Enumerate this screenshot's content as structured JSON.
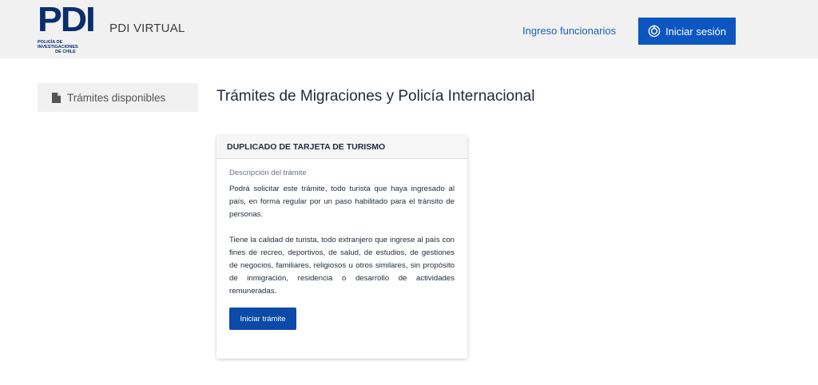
{
  "header": {
    "logo_mark": "PDI",
    "logo_sub_line1": "POLICÍA DE INVESTIGACIONES",
    "logo_sub_line2": "DE CHILE",
    "app_title": "PDI VIRTUAL",
    "officials_link": "Ingreso funcionarios",
    "login_button": "Iniciar sesión",
    "login_icon": "clave-unica-icon",
    "background_color": "#f1f1f1",
    "accent_color": "#0b56c1"
  },
  "sidebar": {
    "items": [
      {
        "label": "Trámites disponibles",
        "icon": "document-icon"
      }
    ]
  },
  "main": {
    "title": "Trámites de Migraciones y Policía Internacional",
    "card": {
      "title": "DUPLICADO DE TARJETA DE TURISMO",
      "description_label": "Descripción del trámite",
      "paragraph_1": "Podrá solicitar este trámite, todo turista que haya ingresado al país, en forma regular por un paso habilitado para el tránsito de personas.",
      "paragraph_2": "Tiene la calidad de turista, todo extranjero que ingrese al país con fines de recreo, deportivos, de salud, de estudios, de gestiones de negocios, familiares, religiosos u otros similares, sin propósito de inmigración, residencia o desarrollo de actividades remuneradas.",
      "start_button": "Iniciar trámite"
    }
  }
}
